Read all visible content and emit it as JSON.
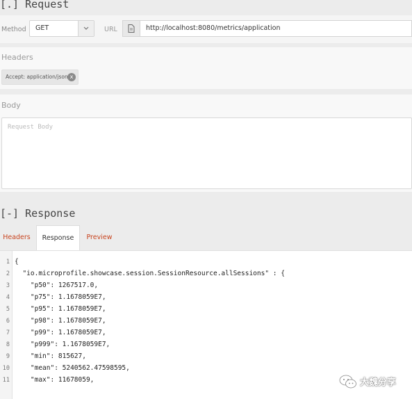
{
  "request": {
    "title": "[.] Request",
    "method_label": "Method",
    "method_value": "GET",
    "url_label": "URL",
    "url_value": "http://localhost:8080/metrics/application",
    "headers_title": "Headers",
    "header_chip": "Accept: application/json",
    "body_title": "Body",
    "body_placeholder": "Request Body"
  },
  "response": {
    "title": "[-] Response",
    "tabs": [
      {
        "label": "Headers"
      },
      {
        "label": "Response"
      },
      {
        "label": "Preview"
      }
    ],
    "active_tab": "Response",
    "lines": [
      {
        "n": "1",
        "text": "{"
      },
      {
        "n": "2",
        "text": "  \"io.microprofile.showcase.session.SessionResource.allSessions\" : {"
      },
      {
        "n": "3",
        "text": "    \"p50\": 1267517.0,"
      },
      {
        "n": "4",
        "text": "    \"p75\": 1.1678059E7,"
      },
      {
        "n": "5",
        "text": "    \"p95\": 1.1678059E7,"
      },
      {
        "n": "6",
        "text": "    \"p98\": 1.1678059E7,"
      },
      {
        "n": "7",
        "text": "    \"p99\": 1.1678059E7,"
      },
      {
        "n": "8",
        "text": "    \"p999\": 1.1678059E7,"
      },
      {
        "n": "9",
        "text": "    \"min\": 815627,"
      },
      {
        "n": "10",
        "text": "    \"mean\": 5240562.47598595,"
      },
      {
        "n": "11",
        "text": "    \"max\": 11678059,"
      }
    ]
  },
  "watermark": {
    "text": "大魏分享",
    "icon": "wechat-icon"
  },
  "colors": {
    "tab_link": "#c8441f",
    "background": "#ececec"
  }
}
